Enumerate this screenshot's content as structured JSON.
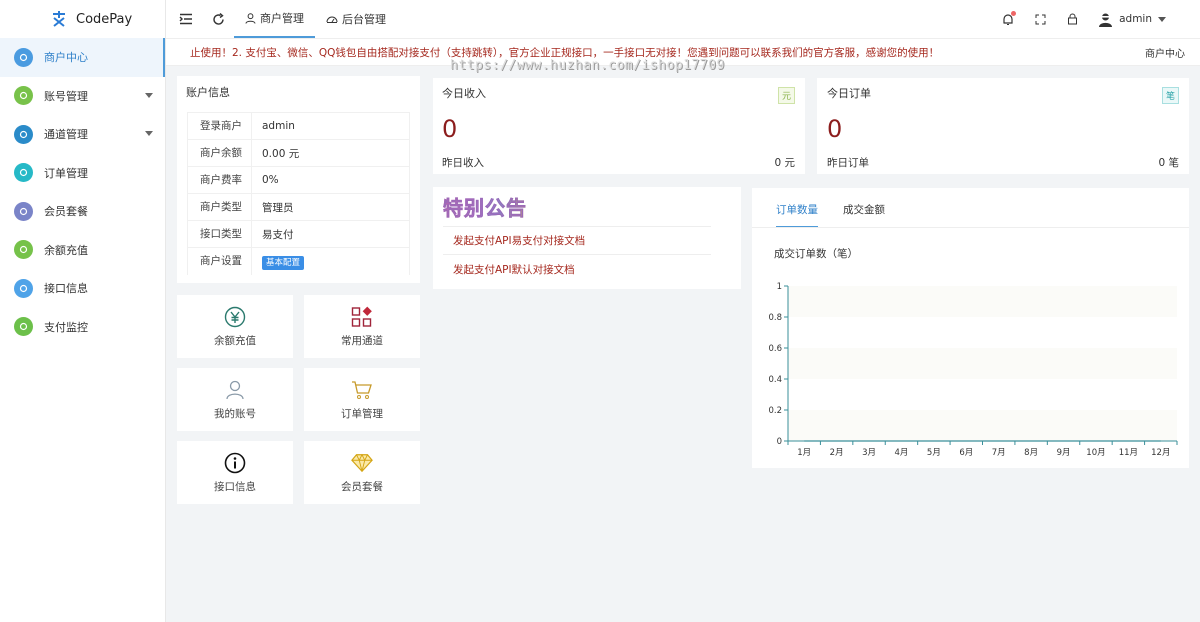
{
  "app": {
    "name": "CodePay"
  },
  "sidebar": {
    "items": [
      {
        "label": "商户中心",
        "icon": "home-icon",
        "color": "#4a9be0",
        "active": true,
        "expandable": false
      },
      {
        "label": "账号管理",
        "icon": "user-icon",
        "color": "#78c24a",
        "active": false,
        "expandable": true
      },
      {
        "label": "通道管理",
        "icon": "grid-icon",
        "color": "#2a8bc9",
        "active": false,
        "expandable": true
      },
      {
        "label": "订单管理",
        "icon": "cart-icon",
        "color": "#26b9c7",
        "active": false,
        "expandable": false
      },
      {
        "label": "会员套餐",
        "icon": "gem-icon",
        "color": "#7a84c8",
        "active": false,
        "expandable": false
      },
      {
        "label": "余额充值",
        "icon": "coin-icon",
        "color": "#76c24a",
        "active": false,
        "expandable": false
      },
      {
        "label": "接口信息",
        "icon": "info-icon",
        "color": "#4fa3e8",
        "active": false,
        "expandable": false
      },
      {
        "label": "支付监控",
        "icon": "monitor-icon",
        "color": "#6cc04a",
        "active": false,
        "expandable": false
      }
    ]
  },
  "topbar": {
    "tabs": [
      {
        "label": "商户管理",
        "icon": "person-icon",
        "active": true
      },
      {
        "label": "后台管理",
        "icon": "dashboard-icon",
        "active": false
      }
    ],
    "user": "admin"
  },
  "notice": {
    "text": "止使用！2. 支付宝、微信、QQ钱包自由搭配对接支付（支持跳转），官方企业正规接口，一手接口无对接！您遇到问题可以联系我们的官方客服，感谢您的使用！",
    "breadcrumb": "商户中心",
    "watermark": "https://www.huzhan.com/ishop17709"
  },
  "account": {
    "title": "账户信息",
    "rows": [
      {
        "key": "登录商户",
        "value": "admin"
      },
      {
        "key": "商户余额",
        "value": "0.00 元"
      },
      {
        "key": "商户费率",
        "value": "0%"
      },
      {
        "key": "商户类型",
        "value": "管理员"
      },
      {
        "key": "接口类型",
        "value": "易支付"
      }
    ],
    "settings_key": "商户设置",
    "settings_button": "基本配置"
  },
  "income": {
    "title": "今日收入",
    "value": "0",
    "unit": "元",
    "sub_label": "昨日收入",
    "sub_value": "0 元"
  },
  "orders": {
    "title": "今日订单",
    "value": "0",
    "unit": "笔",
    "sub_label": "昨日订单",
    "sub_value": "0 笔"
  },
  "quick_links": [
    {
      "label": "余额充值",
      "icon": "yen-icon"
    },
    {
      "label": "常用通道",
      "icon": "apps-icon"
    },
    {
      "label": "我的账号",
      "icon": "user-outline-icon"
    },
    {
      "label": "订单管理",
      "icon": "cart-outline-icon"
    },
    {
      "label": "接口信息",
      "icon": "info-circle-icon"
    },
    {
      "label": "会员套餐",
      "icon": "diamond-icon"
    }
  ],
  "announcement": {
    "title": "特别公告",
    "links": [
      "发起支付API易支付对接文档",
      "发起支付API默认对接文档"
    ]
  },
  "chart_tabs": [
    "订单数量",
    "成交金额"
  ],
  "chart_data": {
    "type": "line",
    "title": "成交订单数（笔）",
    "categories": [
      "1月",
      "2月",
      "3月",
      "4月",
      "5月",
      "6月",
      "7月",
      "8月",
      "9月",
      "10月",
      "11月",
      "12月"
    ],
    "values": [
      0,
      0,
      0,
      0,
      0,
      0,
      0,
      0,
      0,
      0,
      0,
      0
    ],
    "yticks": [
      "1",
      "0.8",
      "0.6",
      "0.4",
      "0.2",
      "0"
    ],
    "ylim": [
      0,
      1
    ],
    "grid": true,
    "color": "#3a8f9a"
  }
}
